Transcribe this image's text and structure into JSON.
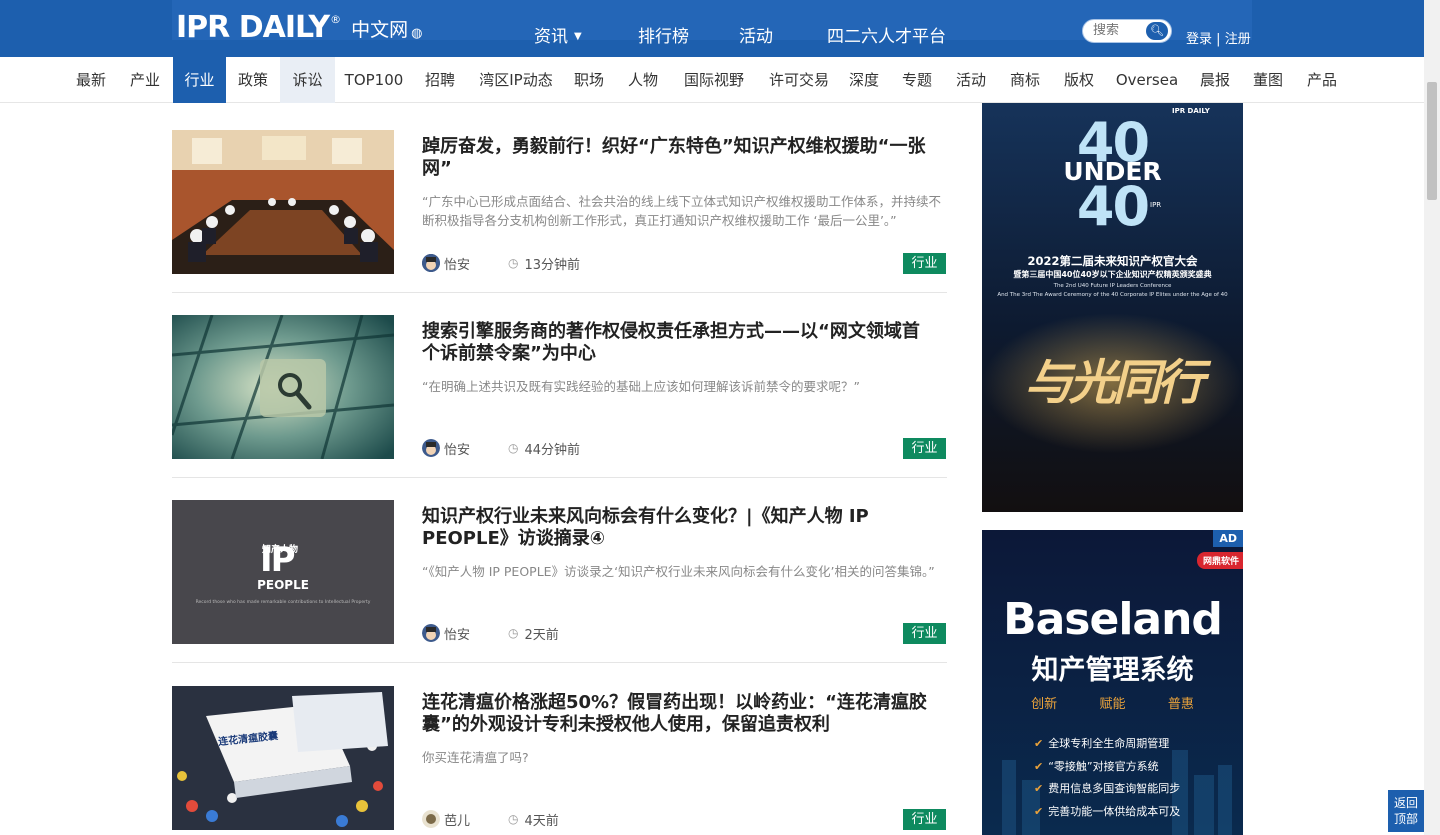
{
  "header": {
    "logo": "IPR DAILY",
    "logo_reg": "®",
    "logo_cn": "中文网",
    "nav": [
      "资讯",
      "排行榜",
      "活动",
      "四二六人才平台"
    ],
    "search_placeholder": "搜索",
    "login": "登录",
    "separator": "|",
    "register": "注册"
  },
  "categories": [
    "最新",
    "产业",
    "行业",
    "政策",
    "诉讼",
    "TOP100",
    "招聘",
    "湾区IP动态",
    "职场",
    "人物",
    "国际视野",
    "许可交易",
    "深度",
    "专题",
    "活动",
    "商标",
    "版权",
    "Oversea",
    "晨报",
    "董图",
    "产品"
  ],
  "active_category": "行业",
  "articles": [
    {
      "title": "踔厉奋发，勇毅前行！织好“广东特色”知识产权维权援助“一张网”",
      "summary": "“广东中心已形成点面结合、社会共治的线上线下立体式知识产权维权援助工作体系，并持续不断积极指导各分支机构创新工作形式，真正打通知识产权维权援助工作 ‘最后一公里’。”",
      "author": "怡安",
      "time": "13分钟前",
      "tag": "行业"
    },
    {
      "title": "搜索引擎服务商的著作权侵权责任承担方式——以“网文领域首个诉前禁令案”为中心",
      "summary": "“在明确上述共识及既有实践经验的基础上应该如何理解该诉前禁令的要求呢？”",
      "author": "怡安",
      "time": "44分钟前",
      "tag": "行业"
    },
    {
      "title": "知识产权行业未来风向标会有什么变化？|《知产人物 IP PEOPLE》访谈摘录④",
      "summary": "“《知产人物 IP PEOPLE》访谈录之‘知识产权行业未来风向标会有什么变化’相关的问答集锦。”",
      "author": "怡安",
      "time": "2天前",
      "tag": "行业",
      "thumb_brand": "知产人物",
      "thumb_big": "IP",
      "thumb_sub": "PEOPLE",
      "thumb_tagline": "Record those who has made remarkable contributions to Intellectual Property"
    },
    {
      "title": "连花清瘟价格涨超50%？假冒药出现！以岭药业：“连花清瘟胶囊”的外观设计专利未授权他人使用，保留追责权利",
      "summary": "你买连花清瘟了吗?",
      "author": "芭儿",
      "time": "4天前",
      "tag": "行业",
      "thumb_box_label": "连花清瘟胶囊"
    }
  ],
  "ad1": {
    "brand": "IPR DAILY",
    "big_top": "40",
    "under": "UNDER",
    "big_bottom": "40",
    "ipr": "IPR",
    "title": "2022第二届未来知识产权官大会",
    "subtitle": "暨第三届中国40位40岁以下企业知识产权精英颁奖盛典",
    "en1": "The 2nd U40 Future IP Leaders Conference",
    "en2": "And The 3rd The Award Ceremony of the 40 Corporate IP Elites under the Age of 40",
    "calligraphy": "与光同行"
  },
  "ad2": {
    "badge": "AD",
    "partner": "网鼎软件",
    "title": "Baseland",
    "subtitle": "知产管理系统",
    "slogans": [
      "创新",
      "赋能",
      "普惠"
    ],
    "features": [
      "全球专利全生命周期管理",
      "“零接触”对接官方系统",
      "费用信息多国查询智能同步",
      "完善功能一体供给成本可及"
    ]
  },
  "backtop": [
    "返回",
    "顶部"
  ],
  "colors": {
    "brand_blue": "#1d5fae",
    "tag_green": "#0e8a5f",
    "ad_dark": "#0b1630"
  }
}
